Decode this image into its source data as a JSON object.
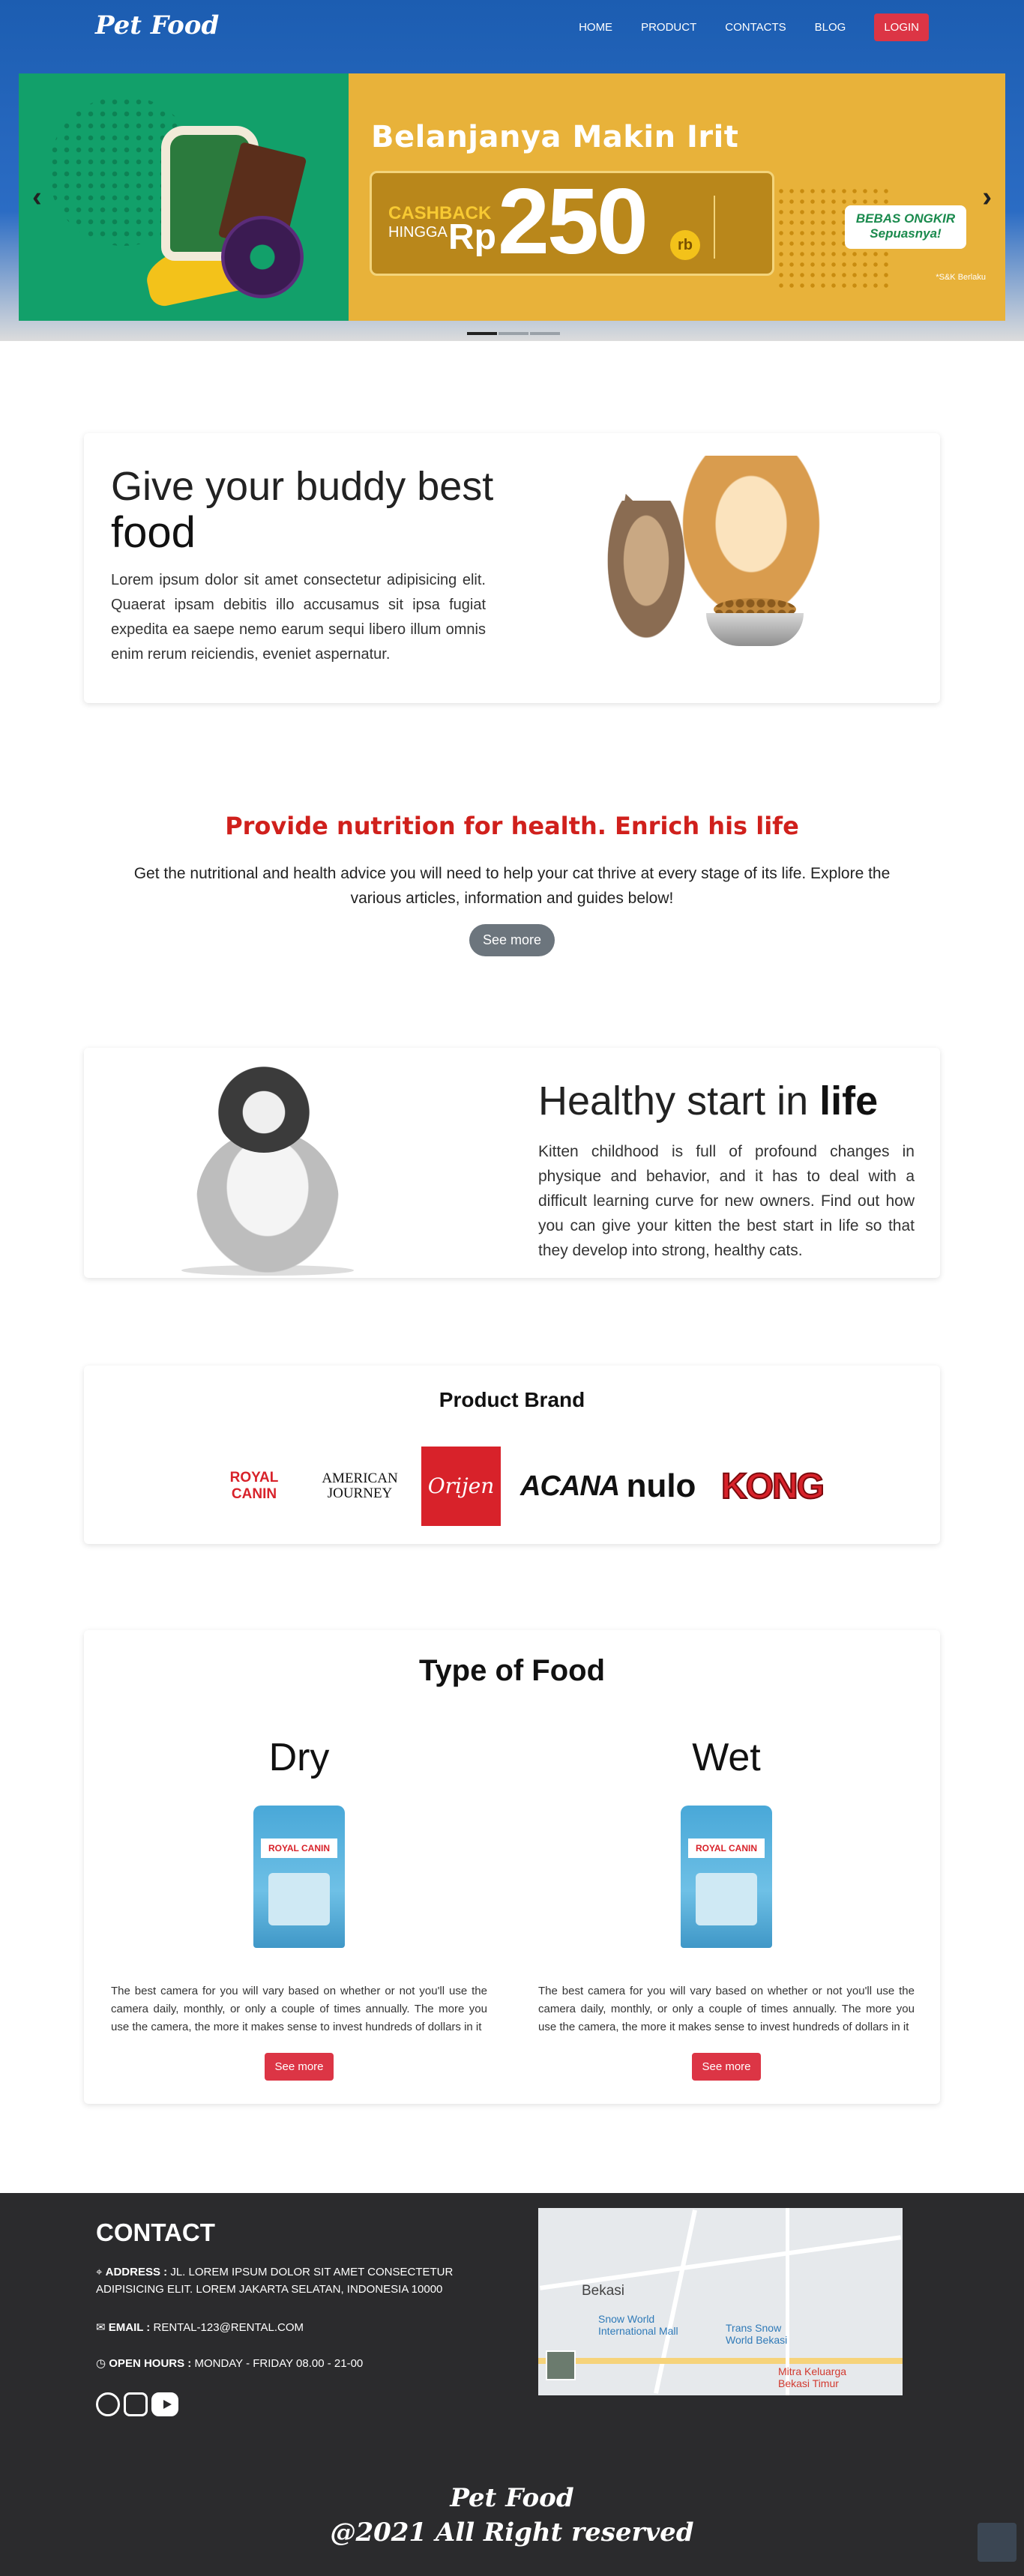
{
  "nav": {
    "brand": "Pet Food",
    "items": [
      "HOME",
      "PRODUCT",
      "CONTACTS",
      "BLOG"
    ],
    "login": "LOGIN"
  },
  "hero": {
    "title": "Belanjanya Makin Irit",
    "cashback": "CASHBACK",
    "hingga": "HINGGA",
    "currency": "Rp",
    "amount": "250",
    "unit": "rb",
    "ongkir_line1": "BEBAS ONGKIR",
    "ongkir_line2": "Sepuasnya!",
    "fine_print": "*S&K Berlaku",
    "prev_icon": "chevron-left-icon",
    "next_icon": "chevron-right-icon"
  },
  "buddy": {
    "title_line1": "Give your buddy best",
    "title_line2": "food",
    "text": "Lorem ipsum dolor sit amet consectetur adipisicing elit. Quaerat ipsam debitis illo accusamus sit ipsa fugiat expedita ea saepe nemo earum sequi libero illum omnis enim rerum reiciendis, eveniet aspernatur."
  },
  "nutrition": {
    "title": "Provide nutrition for health. Enrich his life",
    "text": "Get the nutritional and health advice you will need to help your cat thrive at every stage of its life. Explore the various articles, information and guides below!",
    "button": "See more"
  },
  "healthy": {
    "title_a": "Healthy start in ",
    "title_b": "life",
    "text": "Kitten childhood is full of profound changes in physique and behavior, and it has to deal with a difficult learning curve for new owners. Find out how you can give your kitten the best start in life so that they develop into strong, healthy cats."
  },
  "brands": {
    "title": "Product Brand",
    "logos": [
      "ROYAL CANIN",
      "AMERICAN JOURNEY",
      "Orijen",
      "ACANA",
      "nulo",
      "KONG"
    ]
  },
  "food": {
    "title": "Type of Food",
    "items": [
      {
        "name": "Dry",
        "bag_label": "ROYAL CANIN",
        "text": "The best camera for you will vary based on whether or not you'll use the camera daily, monthly, or only a couple of times annually. The more you use the camera, the more it makes sense to invest hundreds of dollars in it",
        "button": "See more"
      },
      {
        "name": "Wet",
        "bag_label": "ROYAL CANIN",
        "text": "The best camera for you will vary based on whether or not you'll use the camera daily, monthly, or only a couple of times annually. The more you use the camera, the more it makes sense to invest hundreds of dollars in it",
        "button": "See more"
      }
    ]
  },
  "contact": {
    "title": "CONTACT",
    "address_label": "ADDRESS :",
    "address": "JL. LOREM IPSUM DOLOR SIT AMET CONSECTETUR ADIPISICING ELIT. LOREM JAKARTA SELATAN, INDONESIA 10000",
    "email_label": "EMAIL :",
    "email": "RENTAL-123@RENTAL.COM",
    "hours_label": "OPEN HOURS :",
    "hours": "MONDAY - FRIDAY 08.00 - 21-00",
    "map": {
      "city": "Bekasi",
      "place1": "Snow World International Mall",
      "place2": "Trans Snow World Bekasi",
      "place3": "Mitra Keluarga Bekasi Timur"
    }
  },
  "footer": {
    "brand": "Pet Food",
    "copyright": "@2021 All Right reserved"
  }
}
